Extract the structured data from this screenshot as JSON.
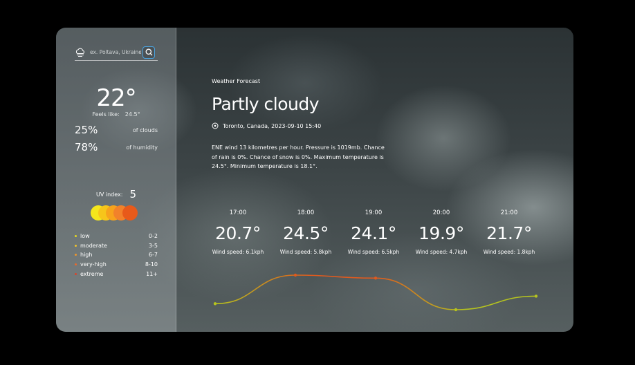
{
  "search": {
    "placeholder": "ex. Poltava, Ukraine"
  },
  "current": {
    "temperature": "22°",
    "feels_like_label": "Feels like:",
    "feels_like_value": "24.5°",
    "clouds_value": "25%",
    "clouds_label": "of clouds",
    "humidity_value": "78%",
    "humidity_label": "of humidity"
  },
  "uv": {
    "label": "UV index:",
    "value": "5",
    "dots": [
      "#f5e61c",
      "#f7c51a",
      "#f7a31c",
      "#f2822a",
      "#e85a1a"
    ],
    "legend": [
      {
        "name": "low",
        "range": "0-2",
        "color": "#e9d91e"
      },
      {
        "name": "moderate",
        "range": "3-5",
        "color": "#f1c22a"
      },
      {
        "name": "high",
        "range": "6-7",
        "color": "#f0962a"
      },
      {
        "name": "very-high",
        "range": "8-10",
        "color": "#eb6a2a"
      },
      {
        "name": "extreme",
        "range": "11+",
        "color": "#d8462a"
      }
    ]
  },
  "forecast": {
    "subtitle": "Weather Forecast",
    "condition": "Partly cloudy",
    "location": "Toronto, Canada, 2023-09-10 15:40",
    "description": "ENE wind 13 kilometres per hour. Pressure is 1019mb. Chance of rain is 0%. Chance of snow is 0%. Maximum temperature is 24.5°. Minimum temperature is 18.1°.",
    "hours": [
      {
        "time": "17:00",
        "temp": "20.7°",
        "wind": "Wind speed: 6.1kph",
        "value": 20.7
      },
      {
        "time": "18:00",
        "temp": "24.5°",
        "wind": "Wind speed: 5.8kph",
        "value": 24.5
      },
      {
        "time": "19:00",
        "temp": "24.1°",
        "wind": "Wind speed: 6.5kph",
        "value": 24.1
      },
      {
        "time": "20:00",
        "temp": "19.9°",
        "wind": "Wind speed: 4.7kph",
        "value": 19.9
      },
      {
        "time": "21:00",
        "temp": "21.7°",
        "wind": "Wind speed: 1.8kph",
        "value": 21.7
      }
    ],
    "curve_colors": {
      "cool": "#b6c41e",
      "warm": "#e05a1e"
    }
  }
}
